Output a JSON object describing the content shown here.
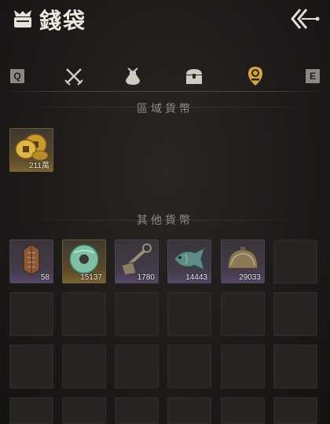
{
  "header": {
    "title": "錢袋"
  },
  "tabs": {
    "left_key": "Q",
    "right_key": "E",
    "items": [
      {
        "name": "weapons-tab",
        "icon": "crossed-swords-icon"
      },
      {
        "name": "pouch-tab",
        "icon": "pouch-icon"
      },
      {
        "name": "chest-tab",
        "icon": "chest-icon"
      },
      {
        "name": "currency-tab",
        "icon": "coin-badge-icon",
        "active": true
      }
    ]
  },
  "regional": {
    "title": "區域貨幣",
    "items": [
      {
        "icon": "gold-coins-icon",
        "qty": "211萬"
      }
    ]
  },
  "other": {
    "title": "其他貨幣",
    "items": [
      {
        "icon": "bronze-token-icon",
        "qty": "58"
      },
      {
        "icon": "jade-disc-icon",
        "qty": "15137"
      },
      {
        "icon": "spade-coin-icon",
        "qty": "1780"
      },
      {
        "icon": "jade-fish-icon",
        "qty": "14443"
      },
      {
        "icon": "bronze-bell-icon",
        "qty": "29033"
      }
    ]
  },
  "colors": {
    "accent": "#d4a63a",
    "qty_text": "#e8e4dc",
    "title_text": "#ece7de"
  }
}
